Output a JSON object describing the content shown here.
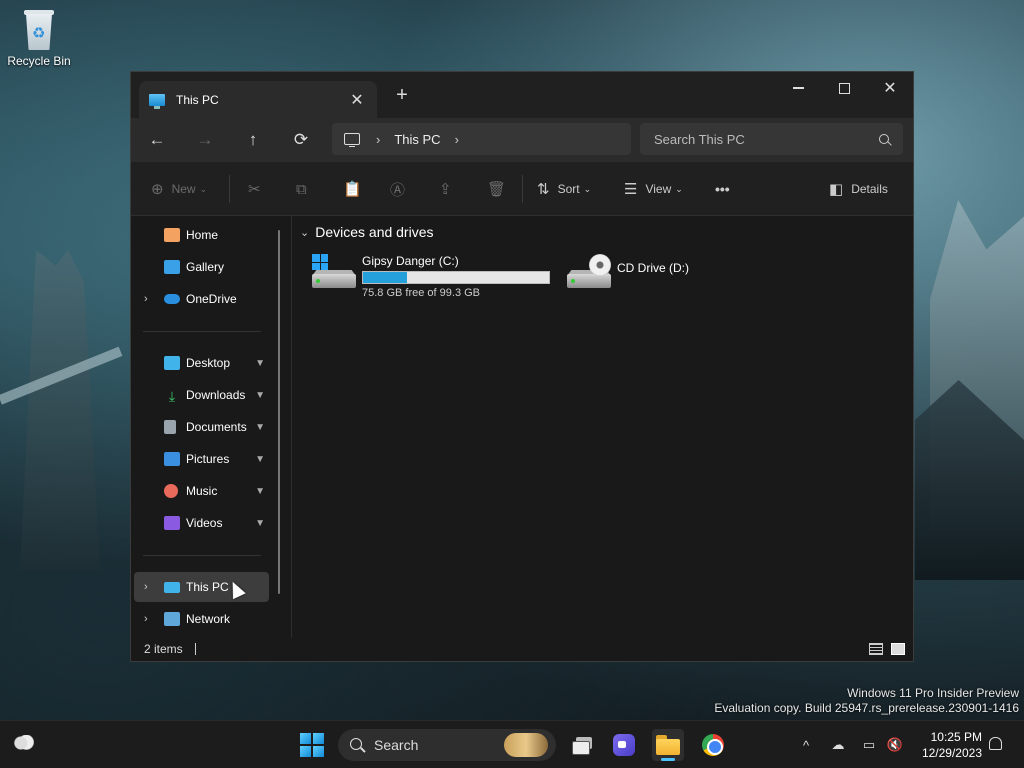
{
  "desktop": {
    "recycle_bin_label": "Recycle Bin",
    "watermark_line1": "Windows 11 Pro Insider Preview",
    "watermark_line2": "Evaluation copy. Build 25947.rs_prerelease.230901-1416"
  },
  "window": {
    "tab_title": "This PC",
    "tab_close": "✕",
    "new_tab": "+",
    "controls": {
      "minimize": "minimize",
      "maximize": "maximize",
      "close": "✕"
    }
  },
  "address_bar": {
    "back": "←",
    "forward": "→",
    "up": "↑",
    "refresh": "⟳",
    "breadcrumb_chevron": "›",
    "crumbs": [
      "This PC"
    ],
    "trailing_chevron": "›",
    "search_placeholder": "Search This PC"
  },
  "command_bar": {
    "new_label": "New",
    "sort_label": "Sort",
    "view_label": "View",
    "more_label": "•••",
    "details_label": "Details",
    "icons": [
      "cut-icon",
      "copy-icon",
      "paste-icon",
      "rename-icon",
      "share-icon",
      "delete-icon"
    ]
  },
  "sidebar": {
    "items": [
      {
        "label": "Home",
        "icon": "home-icon",
        "color": "#f4a261"
      },
      {
        "label": "Gallery",
        "icon": "gallery-icon",
        "color": "#3aa0e8"
      },
      {
        "label": "OneDrive",
        "icon": "onedrive-icon",
        "color": "#2b8fe0",
        "expandable": true
      },
      {
        "label": "Desktop",
        "icon": "desktop-icon",
        "color": "#3fb3ea",
        "pinned": true
      },
      {
        "label": "Downloads",
        "icon": "downloads-icon",
        "color": "#3ec46d",
        "pinned": true
      },
      {
        "label": "Documents",
        "icon": "documents-icon",
        "color": "#9aa4ad",
        "pinned": true
      },
      {
        "label": "Pictures",
        "icon": "pictures-icon",
        "color": "#3a8fe0",
        "pinned": true
      },
      {
        "label": "Music",
        "icon": "music-icon",
        "color": "#e86a5a",
        "pinned": true
      },
      {
        "label": "Videos",
        "icon": "videos-icon",
        "color": "#8a5ae0",
        "pinned": true
      },
      {
        "label": "This PC",
        "icon": "this-pc-icon",
        "color": "#3fb3ea",
        "expandable": true,
        "selected": true
      },
      {
        "label": "Network",
        "icon": "network-icon",
        "color": "#5fa7d8",
        "expandable": true
      }
    ],
    "expand_glyph": "›",
    "pin_glyph": "📌"
  },
  "content": {
    "group_title": "Devices and drives",
    "group_chevron": "⌄",
    "drives": [
      {
        "name": "Gipsy Danger (C:)",
        "free_text": "75.8 GB free of 99.3 GB",
        "used_fraction": 0.237,
        "bar_color": "#26a0da"
      },
      {
        "name": "CD Drive (D:)"
      }
    ]
  },
  "status_bar": {
    "items_text": "2 items"
  },
  "taskbar": {
    "search_label": "Search",
    "clock_time": "10:25 PM",
    "clock_date": "12/29/2023",
    "tray_chevron": "^"
  }
}
